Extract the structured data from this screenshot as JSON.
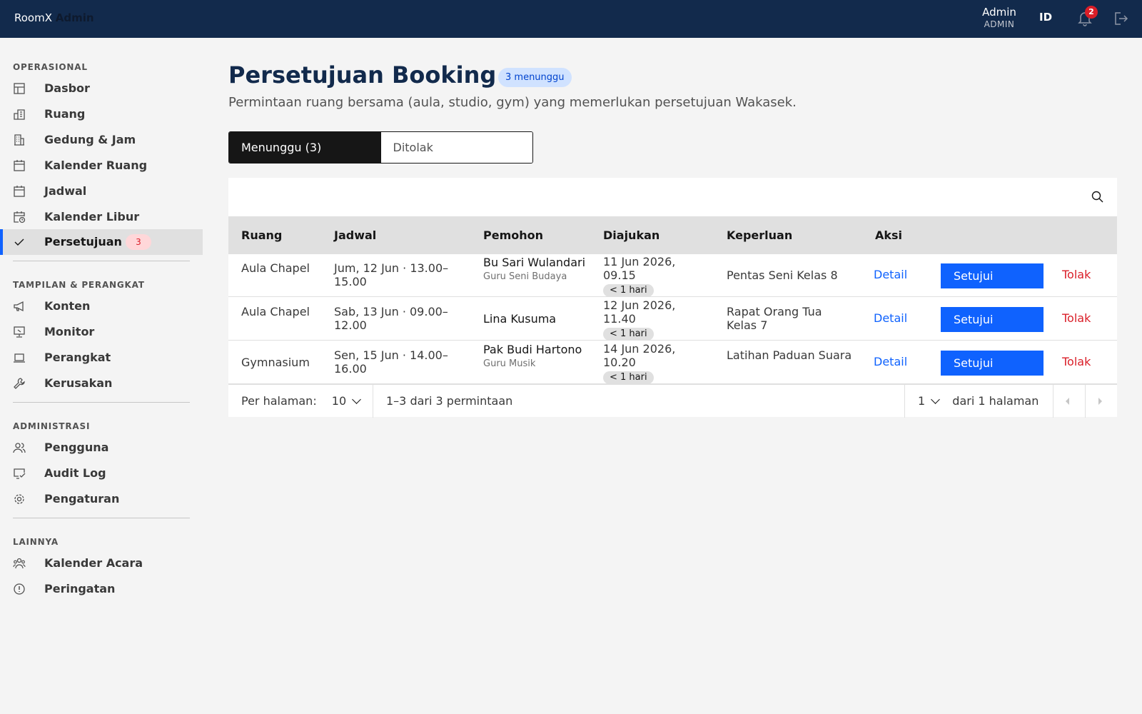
{
  "header": {
    "brand_part1": "RoomX",
    "brand_part2": "Admin",
    "user_name": "Admin",
    "user_role": "ADMIN",
    "language": "ID",
    "notification_count": "2",
    "bell_icon": "bell-icon",
    "logout_icon": "logout-icon"
  },
  "sidebar": {
    "sections": [
      {
        "title": "OPERASIONAL"
      },
      {
        "title": "TAMPILAN & PERANGKAT"
      },
      {
        "title": "ADMINISTRASI"
      },
      {
        "title": "LAINNYA"
      }
    ],
    "items": [
      {
        "label": "Dasbor",
        "icon": "dashboard-icon"
      },
      {
        "label": "Ruang",
        "icon": "room-icon"
      },
      {
        "label": "Gedung & Jam",
        "icon": "building-icon"
      },
      {
        "label": "Kalender Ruang",
        "icon": "calendar-icon"
      },
      {
        "label": "Jadwal",
        "icon": "calendar-icon"
      },
      {
        "label": "Kalender Libur",
        "icon": "calendar-clock-icon"
      },
      {
        "label": "Persetujuan",
        "icon": "checkmark-icon",
        "badge": "3",
        "active": true
      },
      {
        "label": "Konten",
        "icon": "megaphone-icon"
      },
      {
        "label": "Monitor",
        "icon": "monitor-icon"
      },
      {
        "label": "Perangkat",
        "icon": "laptop-icon"
      },
      {
        "label": "Kerusakan",
        "icon": "wrench-icon"
      },
      {
        "label": "Pengguna",
        "icon": "users-icon"
      },
      {
        "label": "Audit Log",
        "icon": "audit-icon"
      },
      {
        "label": "Pengaturan",
        "icon": "gear-icon"
      },
      {
        "label": "Kalender Acara",
        "icon": "group-icon"
      },
      {
        "label": "Peringatan",
        "icon": "warning-icon"
      }
    ]
  },
  "page": {
    "title": "Persetujuan Booking",
    "pending_pill": "3 menunggu",
    "subtitle": "Permintaan ruang bersama (aula, studio, gym) yang memerlukan persetujuan Wakasek."
  },
  "tabs": [
    {
      "label": "Menunggu (3)",
      "selected": true
    },
    {
      "label": "Ditolak",
      "selected": false
    }
  ],
  "table": {
    "search_icon": "search-icon",
    "columns": [
      "Ruang",
      "Jadwal",
      "Pemohon",
      "Diajukan",
      "Keperluan",
      "Aksi"
    ],
    "rows": [
      {
        "ruang": "Aula Chapel",
        "jadwal": "Jum, 12 Jun · 13.00–15.00",
        "pemohon": "Bu Sari Wulandari",
        "pemohon_role": "Guru Seni Budaya",
        "diajukan": "11 Jun 2026, 09.15",
        "age": "< 1 hari",
        "keperluan": "Pentas Seni Kelas 8"
      },
      {
        "ruang": "Aula Chapel",
        "jadwal": "Sab, 13 Jun · 09.00–12.00",
        "pemohon": "Lina Kusuma",
        "pemohon_role": "",
        "diajukan": "12 Jun 2026, 11.40",
        "age": "< 1 hari",
        "keperluan": "Rapat Orang Tua Kelas 7"
      },
      {
        "ruang": "Gymnasium",
        "jadwal": "Sen, 15 Jun · 14.00–16.00",
        "pemohon": "Pak Budi Hartono",
        "pemohon_role": "Guru Musik",
        "diajukan": "14 Jun 2026, 10.20",
        "age": "< 1 hari",
        "keperluan": "Latihan Paduan Suara"
      }
    ],
    "actions": {
      "detail": "Detail",
      "approve": "Setujui",
      "reject": "Tolak"
    }
  },
  "pagination": {
    "per_page_label": "Per halaman:",
    "per_page_value": "10",
    "range_text": "1–3 dari 3 permintaan",
    "current_page": "1",
    "total_pages_text": "dari 1 halaman"
  },
  "colors": {
    "header_bg": "#122a4c",
    "primary": "#0f62fe",
    "danger": "#da1e28"
  }
}
